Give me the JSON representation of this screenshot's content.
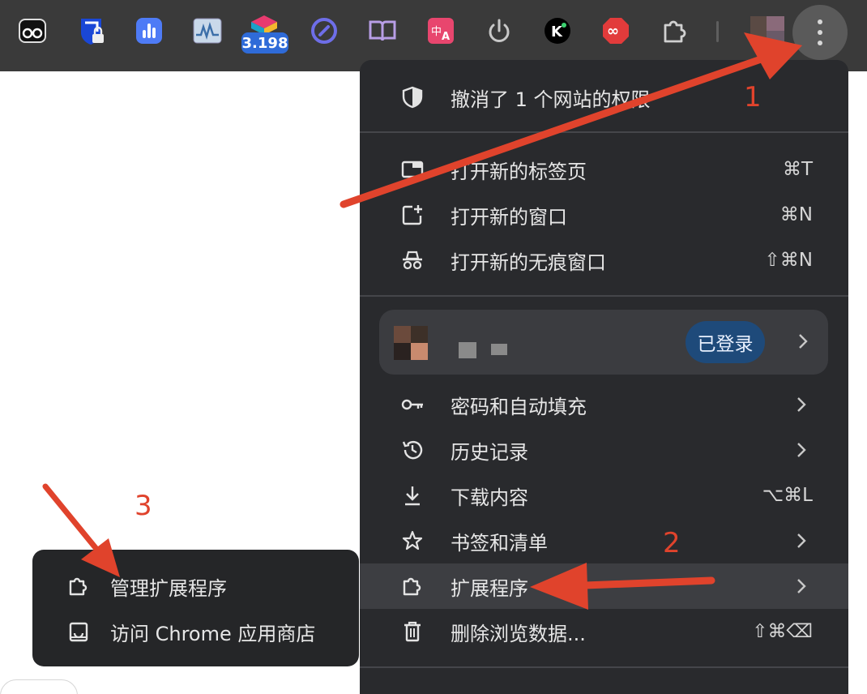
{
  "toolbar": {
    "extension_badge": "3.198",
    "extensions": [
      {
        "icon": "bitwarden-eyes-icon"
      },
      {
        "icon": "shield-lock-icon"
      },
      {
        "icon": "bar-chart-icon"
      },
      {
        "icon": "waveform-icon"
      },
      {
        "icon": "colorful-cube-icon"
      },
      {
        "icon": "at-circle-icon"
      },
      {
        "icon": "open-book-icon"
      },
      {
        "icon": "translate-icon"
      },
      {
        "icon": "power-icon"
      },
      {
        "icon": "k-logo-icon"
      },
      {
        "icon": "infinity-stop-icon"
      },
      {
        "icon": "puzzle-icon"
      }
    ]
  },
  "menu": {
    "revoke": {
      "label": "撤消了 1 个网站的权限"
    },
    "new_tab": {
      "label": "打开新的标签页",
      "shortcut": "⌘T"
    },
    "new_window": {
      "label": "打开新的窗口",
      "shortcut": "⌘N"
    },
    "incognito": {
      "label": "打开新的无痕窗口",
      "shortcut": "⇧⌘N"
    },
    "profile": {
      "status": "已登录"
    },
    "passwords": {
      "label": "密码和自动填充"
    },
    "history": {
      "label": "历史记录"
    },
    "downloads": {
      "label": "下载内容",
      "shortcut": "⌥⌘L"
    },
    "bookmarks": {
      "label": "书签和清单"
    },
    "extensions": {
      "label": "扩展程序"
    },
    "clear_data": {
      "label": "删除浏览数据...",
      "shortcut": "⇧⌘⌫"
    }
  },
  "submenu": {
    "manage": {
      "label": "管理扩展程序"
    },
    "store": {
      "label": "访问 Chrome 应用商店"
    }
  },
  "annotations": {
    "step1": "1",
    "step2": "2",
    "step3": "3",
    "color": "#e0432c"
  }
}
